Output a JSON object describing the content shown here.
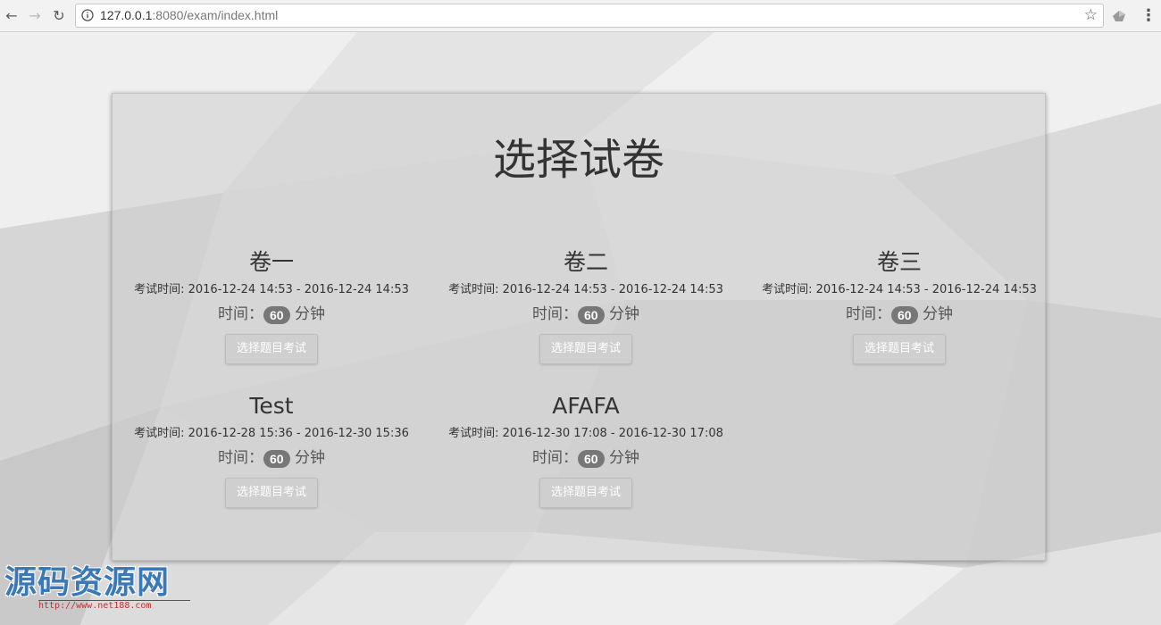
{
  "browser": {
    "url_host": "127.0.0.1",
    "url_rest": ":8080/exam/index.html"
  },
  "page": {
    "title": "选择试卷",
    "time_label": "时间：",
    "minute_unit": "分钟",
    "button_label": "选择题目考试",
    "exams": [
      {
        "name": "卷一",
        "time_range": "考试时间: 2016-12-24 14:53 - 2016-12-24 14:53",
        "duration": "60"
      },
      {
        "name": "卷二",
        "time_range": "考试时间: 2016-12-24 14:53 - 2016-12-24 14:53",
        "duration": "60"
      },
      {
        "name": "卷三",
        "time_range": "考试时间: 2016-12-24 14:53 - 2016-12-24 14:53",
        "duration": "60"
      },
      {
        "name": "Test",
        "time_range": "考试时间: 2016-12-28 15:36 - 2016-12-30 15:36",
        "duration": "60"
      },
      {
        "name": "AFAFA",
        "time_range": "考试时间: 2016-12-30 17:08 - 2016-12-30 17:08",
        "duration": "60"
      }
    ]
  },
  "watermark": {
    "text": "源码资源网",
    "url": "http://www.net188.com"
  }
}
